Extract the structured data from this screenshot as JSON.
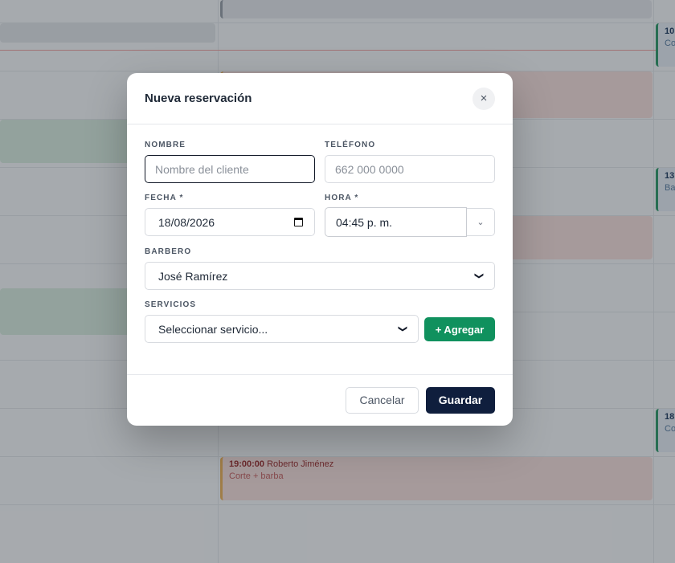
{
  "calendar": {
    "events": [
      {
        "time": "10:",
        "sub": "Co"
      },
      {
        "time": "13:",
        "sub": "Ba"
      },
      {
        "time": "18:",
        "sub": "Co"
      },
      {
        "time": "19:00:00",
        "client": "Roberto Jiménez",
        "service": "Corte + barba"
      }
    ]
  },
  "modal": {
    "title": "Nueva reservación",
    "close_icon": "×",
    "fields": {
      "nombre": {
        "label": "NOMBRE",
        "placeholder": "Nombre del cliente",
        "value": ""
      },
      "telefono": {
        "label": "TELÉFONO",
        "placeholder": "662 000 0000",
        "value": ""
      },
      "fecha": {
        "label": "FECHA *",
        "value": "18/08/2026"
      },
      "hora": {
        "label": "HORA *",
        "value": "04:45 p. m."
      },
      "barbero": {
        "label": "BARBERO",
        "selected": "José Ramírez"
      },
      "servicios": {
        "label": "SERVICIOS",
        "selected": "Seleccionar servicio...",
        "add_label": "+ Agregar"
      }
    },
    "footer": {
      "cancel_label": "Cancelar",
      "save_label": "Guardar"
    }
  },
  "colors": {
    "accent_green": "#10915e",
    "primary_dark": "#0f1e3d"
  }
}
